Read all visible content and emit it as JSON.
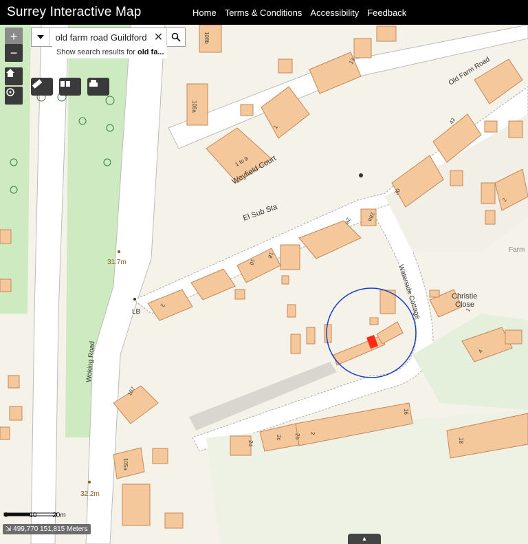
{
  "app": {
    "title": "Surrey Interactive Map"
  },
  "nav": {
    "items": [
      "Home",
      "Terms & Conditions",
      "Accessibility",
      "Feedback"
    ]
  },
  "search": {
    "value": "old farm road Guildford",
    "suggestion_prefix": "Show search results for ",
    "suggestion_bold": "old fa..."
  },
  "controls": {
    "zoom_in": "+",
    "zoom_out": "−"
  },
  "map_labels": {
    "old_farm_road": "Old Farm Road",
    "weyfield_court": "Weyfield Court",
    "weyfield_nums": "1 to 9",
    "el_sub_sta": "El Sub Sta",
    "waterside_cottage": "Waterside Cottage",
    "christie_close_1": "Christie",
    "christie_close_2": "Close",
    "woking_road": "Woking Road",
    "spot_height_1": "31.7m",
    "spot_height_2": "32.2m",
    "lb": "LB",
    "farm": "Farm",
    "house_108b": "108b",
    "house_108a": "108a",
    "house_13": "13",
    "house_1": "1",
    "house_42": "42",
    "house_30": "30",
    "house_2a": "2",
    "house_28a": "28a",
    "house_28": "28",
    "house_18": "18",
    "house_10": "10",
    "house_2": "2",
    "house_1c": "1",
    "house_4": "4",
    "house_107": "107",
    "house_105a": "105a",
    "house_2d": "2d",
    "house_2c": "2c",
    "house_2b": "2b",
    "house_2e": "2",
    "house_16": "16",
    "house_18b": "18"
  },
  "scale": {
    "t0": "0",
    "t10": "10",
    "t20": "20m"
  },
  "coords": {
    "text": "499,770 151,815 Meters"
  },
  "colors": {
    "building": "#f4c89b",
    "building_stroke": "#c4875a",
    "park": "#cdeac1",
    "road": "#ffffff",
    "highlight": "#ff2a1a",
    "circle": "#1a3fbf"
  }
}
